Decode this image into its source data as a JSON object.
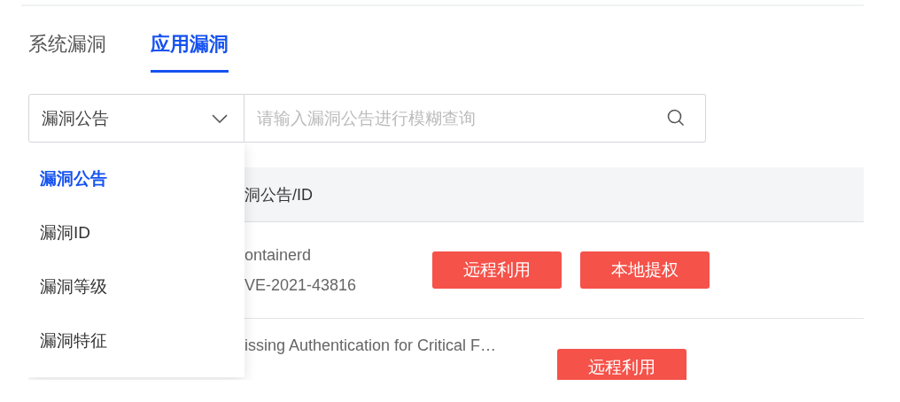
{
  "tabs": [
    {
      "label": "系统漏洞",
      "selected": false
    },
    {
      "label": "应用漏洞",
      "selected": true
    }
  ],
  "search": {
    "field_select": "漏洞公告",
    "placeholder": "请输入漏洞公告进行模糊查询"
  },
  "dropdown": {
    "options": [
      {
        "label": "漏洞公告",
        "selected": true
      },
      {
        "label": "漏洞ID",
        "selected": false
      },
      {
        "label": "漏洞等级",
        "selected": false
      },
      {
        "label": "漏洞特征",
        "selected": false
      }
    ]
  },
  "table": {
    "columns": [
      "洞公告/ID"
    ],
    "rows": [
      {
        "name": "ontainerd",
        "id": "VE-2021-43816",
        "tags": [
          "远程利用",
          "本地提权"
        ]
      },
      {
        "name": "issing Authentication for Critical F…",
        "tags": [
          "远程利用"
        ]
      }
    ]
  }
}
